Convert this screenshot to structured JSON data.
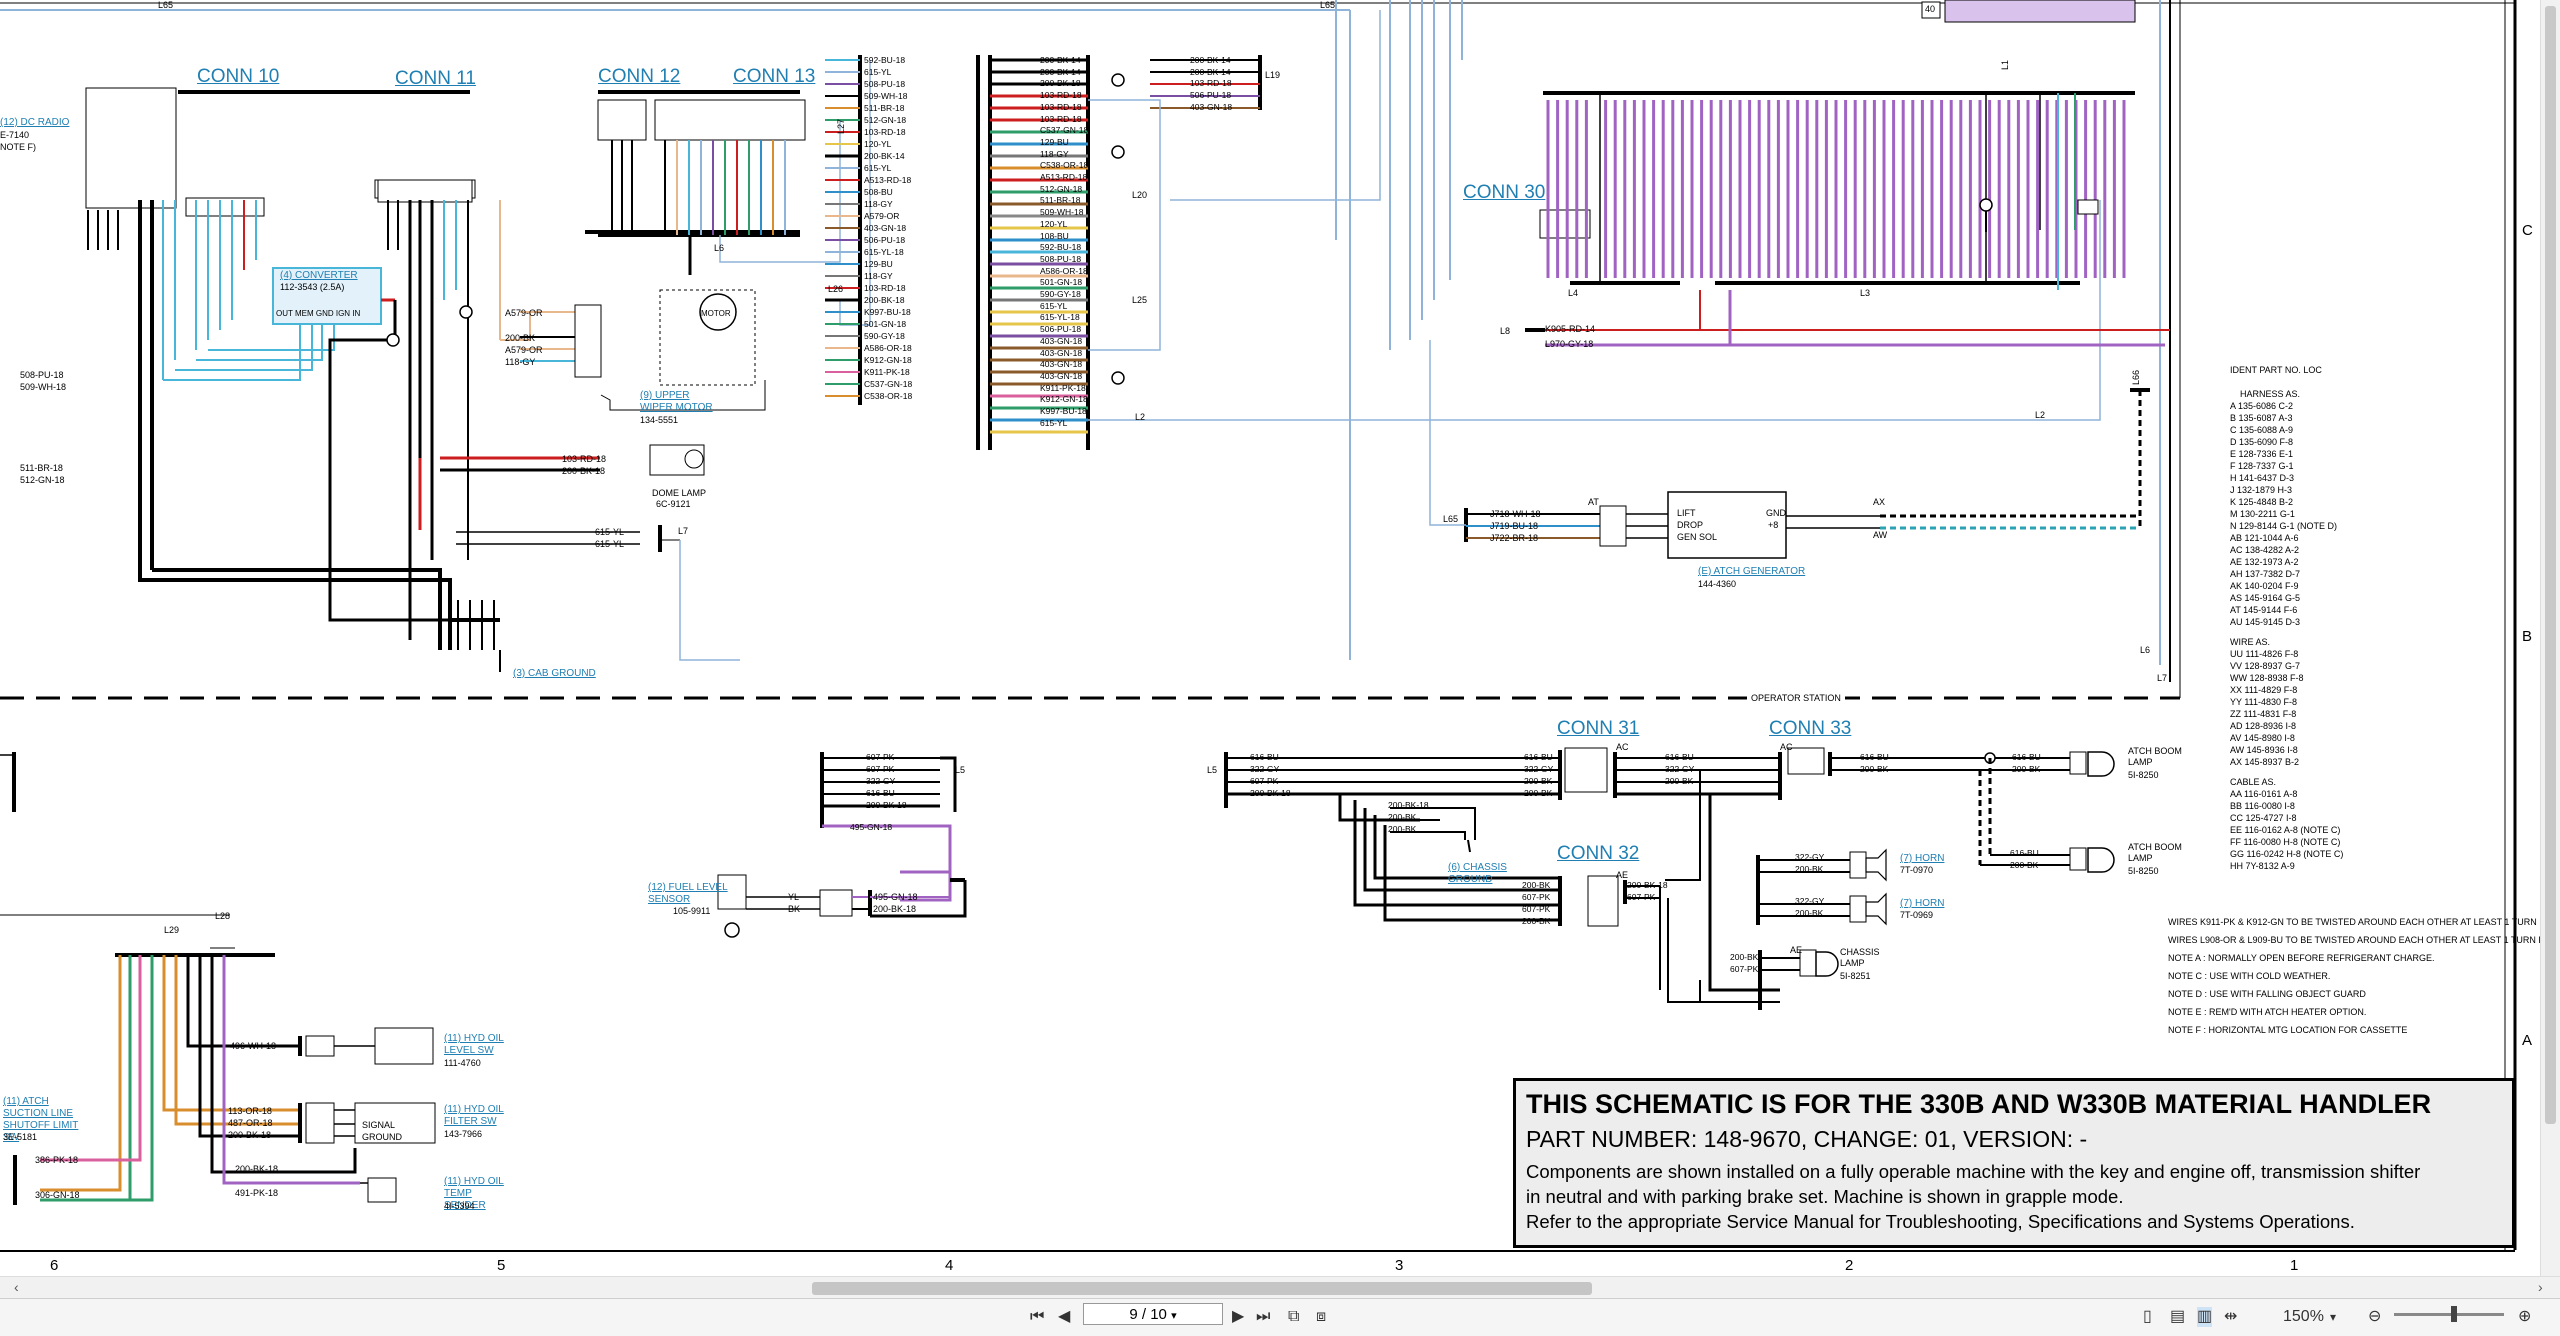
{
  "document": {
    "connectors": {
      "c10": "CONN 10",
      "c11": "CONN 11",
      "c12": "CONN 12",
      "c13": "CONN 13",
      "c30": "CONN 30",
      "c31": "CONN 31",
      "c32": "CONN 32",
      "c33": "CONN 33"
    },
    "lines": {
      "L65": "L65",
      "L27": "L27",
      "L19": "L19",
      "L20": "L20",
      "L25": "L25",
      "L2": "L2",
      "L26": "L26",
      "L6": "L6",
      "L7": "L7",
      "L4": "L4",
      "L3": "L3",
      "L8": "L8",
      "L66": "L66",
      "L5": "L5",
      "L28": "L28",
      "L29": "L29",
      "L1": "L1"
    },
    "labels": {
      "radio": "(12) DC RADIO",
      "radio_sub": "E-7140",
      "note_f": "NOTE F)",
      "converter": "(4) CONVERTER",
      "converter_part": "112-3543 (2.5A)",
      "converter_pins": "OUT  MEM  GND  IGN  IN",
      "wiper": "(9) UPPER WIPER MOTOR",
      "wiper_part": "134-5551",
      "motor": "MOTOR",
      "dome_lamp": "DOME LAMP",
      "dome_part": "6C-9121",
      "cab_ground": "(3) CAB GROUND",
      "atch_gen": "(E) ATCH GENERATOR",
      "atch_gen_part": "144-4360",
      "lift": "LIFT",
      "drop": "DROP",
      "gen_sol": "GEN SOL",
      "gnd": "GND",
      "plus8": "+8",
      "operator_station": "OPERATOR STATION",
      "fuel": "(12) FUEL LEVEL SENSOR",
      "fuel_part": "105-9911",
      "chassis_ground": "(6) CHASSIS GROUND",
      "horn1": "(7) HORN",
      "horn1_part": "7T-0970",
      "horn2": "(7) HORN",
      "horn2_part": "7T-0969",
      "chassis_lamp": "CHASSIS LAMP",
      "chassis_lamp_part": "5I-8251",
      "boom1": "ATCH BOOM LAMP",
      "boom1_part": "5I-8250",
      "boom2": "ATCH BOOM LAMP",
      "boom2_part": "5I-8250",
      "hyd_oil_level": "(11) HYD OIL LEVEL SW",
      "hyd_oil_level_part": "111-4760",
      "hyd_oil_filter": "(11) HYD OIL FILTER SW",
      "hyd_oil_filter_part": "143-7966",
      "hyd_temp": "(11) HYD OIL TEMP SENDER",
      "hyd_temp_part": "4I-5394",
      "signal": "SIGNAL",
      "ground": "GROUND",
      "suction": "(11) ATCH SUCTION LINE SHUTOFF LIMIT SW",
      "suction_part": "3E-5181",
      "at": "AT",
      "ax": "AX",
      "aw": "AW",
      "ae": "AE",
      "ac": "AC",
      "top_40": "40"
    },
    "wires_left": [
      "508-PU-18",
      "509-WH-18",
      "511-BR-18",
      "512-GN-18"
    ],
    "wires_conn12_bundle": [
      "A579-OR",
      "200-BK",
      "A579-OR",
      "118-GY"
    ],
    "wires_dome": [
      "103-RD-18",
      "200-BK-18"
    ],
    "wires_615": [
      "615-YL",
      "615-YL"
    ],
    "wires_harness1": [
      "592-BU-18",
      "615-YL",
      "508-PU-18",
      "509-WH-18",
      "511-BR-18",
      "512-GN-18",
      "103-RD-18",
      "120-YL",
      "200-BK-14",
      "615-YL",
      "A513-RD-18",
      "508-BU",
      "118-GY",
      "A579-OR",
      "403-GN-18",
      "506-PU-18",
      "615-YL-18",
      "129-BU",
      "118-GY",
      "103-RD-18",
      "200-BK-18",
      "K997-BU-18",
      "501-GN-18",
      "590-GY-18",
      "A586-OR-18",
      "K912-GN-18",
      "K911-PK-18",
      "C537-GN-18",
      "C538-OR-18"
    ],
    "wires_harness2": [
      "200-BK-14",
      "200-BK-14",
      "200-BK-18",
      "103-RD-18",
      "103-RD-18",
      "103-RD-18",
      "C537-GN-18",
      "129-BU",
      "118-GY",
      "C538-OR-18",
      "A513-RD-18",
      "512-GN-18",
      "511-BR-18",
      "509-WH-18",
      "120-YL",
      "108-BU",
      "592-BU-18",
      "508-PU-18",
      "A586-OR-18",
      "501-GN-18",
      "590-GY-18",
      "615-YL",
      "615-YL-18",
      "506-PU-18",
      "403-GN-18",
      "403-GN-18",
      "403-GN-18",
      "403-GN-18",
      "K911-PK-18",
      "K912-GN-18",
      "K997-BU-18",
      "615-YL"
    ],
    "wires_l19": [
      "200-BK-14",
      "200-BK-14",
      "103-RD-18",
      "506-PU-18",
      "403-GN-18"
    ],
    "wires_l8": [
      "K905-RD-14",
      "L970-GY-18"
    ],
    "wires_l65": [
      "J718-WH-18",
      "J719-BU-18",
      "J722-BR-18"
    ],
    "wires_l5a": [
      "607-PK",
      "607-PK",
      "322-GY",
      "616-BU",
      "200-BK-18",
      "495-GN-18"
    ],
    "wires_l5b": [
      "616-BU",
      "322-GY",
      "607-PK",
      "200-BK-18"
    ],
    "wires_conn31": [
      "616-BU",
      "322-GY",
      "200-BK",
      "200-BK"
    ],
    "wires_conn31r": [
      "616-BU",
      "322-GY",
      "200-BK"
    ],
    "wires_conn33": [
      "616-BU",
      "200-BK"
    ],
    "wires_boom1": [
      "616-BU",
      "200-BK"
    ],
    "wires_boom2": [
      "616-BU",
      "200-BK"
    ],
    "wires_gnd": [
      "200-BK-18",
      "200-BK",
      "200-BK"
    ],
    "wires_conn32": [
      "200-BK",
      "607-PK",
      "607-PK",
      "200-BK"
    ],
    "wires_conn32r": [
      "200-BK-18",
      "607-PK"
    ],
    "wires_horn": [
      "322-GY",
      "200-BK",
      "322-GY",
      "200-BK"
    ],
    "wires_lamp": [
      "200-BK",
      "607-PK"
    ],
    "wires_fuel": [
      "495-GN-18",
      "200-BK-18"
    ],
    "wires_fuel_yl": [
      "YL",
      "BK"
    ],
    "wires_hyd": [
      "496-WH-18",
      "113-OR-18",
      "487-OR-18",
      "200-BK-18",
      "200-BK-18",
      "491-PK-18"
    ],
    "wires_suction": [
      "386-PK-18",
      "306-GN-18"
    ],
    "ident": {
      "header": "IDENT        PART NO.          LOC",
      "harness_title": "HARNESS AS.",
      "harness": [
        "A   135-6086   C-2",
        "B   135-6087   A-3",
        "C   135-6088   A-9",
        "D   135-6090   F-8",
        "E   128-7336   E-1",
        "F   128-7337   G-1",
        "H   141-6437   D-3",
        "J   132-1879   H-3",
        "K   125-4848   B-2",
        "M   130-2211   G-1",
        "N   129-8144   G-1 (NOTE D)",
        "AB  121-1044   A-6",
        "AC  138-4282   A-2",
        "AE  132-1973   A-2",
        "AH  137-7382   D-7",
        "AK  140-0204   F-9",
        "AS  145-9164   G-5",
        "AT  145-9144   F-6",
        "AU  145-9145   D-3"
      ],
      "wire_title": "WIRE AS.",
      "wire": [
        "UU  111-4826   F-8",
        "VV  128-8937   G-7",
        "WW  128-8938   F-8",
        "XX  111-4829   F-8",
        "YY  111-4830   F-8",
        "ZZ  111-4831   F-8",
        "AD  128-8936   I-8",
        "AV  145-8980   I-8",
        "AW  145-8936   I-8",
        "AX  145-8937   B-2"
      ],
      "cable_title": "CABLE AS.",
      "cable": [
        "AA  116-0161   A-8",
        "BB  116-0080   I-8",
        "CC  125-4727   I-8",
        "EE  116-0162   A-8       (NOTE C)",
        "FF  116-0080   H-8       (NOTE C)",
        "GG  116-0242   H-8       (NOTE C)",
        "HH  7Y-8132   A-9"
      ]
    },
    "notes": [
      "WIRES K911-PK & K912-GN TO BE TWISTED AROUND EACH OTHER AT LEAST 1 TURN PER 25 mm.",
      "WIRES L908-OR & L909-BU TO BE TWISTED AROUND EACH OTHER AT LEAST 1 TURN PER 25 mm.",
      "NOTE A : NORMALLY OPEN BEFORE REFRIGERANT CHARGE.",
      "NOTE C : USE WITH COLD WEATHER.",
      "NOTE D : USE WITH FALLING OBJECT GUARD",
      "NOTE E : REM'D WITH ATCH HEATER OPTION.",
      "NOTE F : HORIZONTAL MTG LOCATION FOR CASSETTE"
    ],
    "title_block": {
      "title": "THIS SCHEMATIC IS FOR THE 330B AND W330B MATERIAL HANDLER",
      "part": "PART NUMBER: 148-9670, CHANGE: 01, VERSION: -",
      "desc1": "Components are shown installed on a fully operable machine with the key and engine off, transmission shifter",
      "desc2": "in neutral and with parking brake set. Machine is shown in grapple mode.",
      "desc3": "Refer to the appropriate Service Manual for Troubleshooting, Specifications and Systems Operations."
    },
    "scale": [
      "6",
      "5",
      "4",
      "3",
      "2",
      "1"
    ],
    "zones": [
      "C",
      "B",
      "A"
    ]
  },
  "viewer": {
    "page_current": "9",
    "page_total": "10",
    "page_display": "9 / 10",
    "zoom": "150%",
    "icons": [
      "first-page-icon",
      "prev-page-icon",
      "next-page-icon",
      "last-page-icon"
    ]
  }
}
